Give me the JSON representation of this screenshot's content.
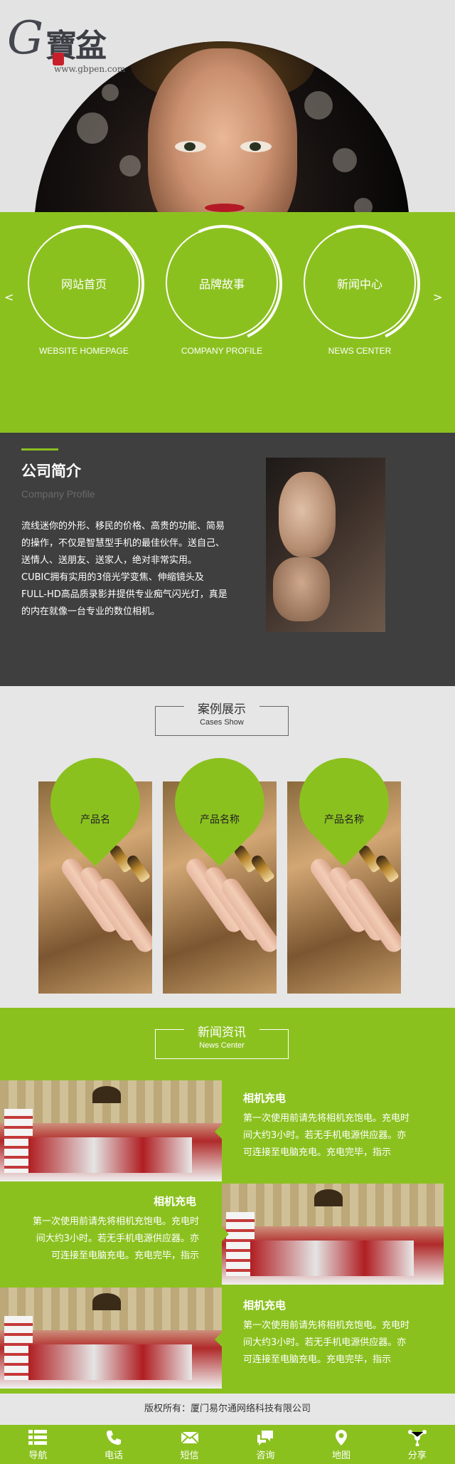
{
  "brand": {
    "logo_letter": "G",
    "logo_cn": "寶盆",
    "logo_url": "www.gbpen.com"
  },
  "nav": {
    "prev": "<",
    "next": ">",
    "items": [
      {
        "label": "网站首页",
        "en": "WEBSITE HOMEPAGE"
      },
      {
        "label": "品牌故事",
        "en": "COMPANY PROFILE"
      },
      {
        "label": "新闻中心",
        "en": "NEWS CENTER"
      }
    ]
  },
  "profile": {
    "title": "公司简介",
    "subtitle": "Company Profile",
    "text": "流线迷你的外形、移民的价格、高贵的功能、简易的操作，不仅是智慧型手机的最佳伙伴。送自己、送情人、送朋友、送家人，绝对非常实用。 CUBIC拥有实用的3倍光学变焦、伸缩镜头及FULL-HD高品质录影并提供专业痴气闪光灯，真是的内在就像一台专业的数位相机。"
  },
  "cases": {
    "title": "案例展示",
    "subtitle": "Cases Show",
    "items": [
      {
        "label": "产品名"
      },
      {
        "label": "产品名称"
      },
      {
        "label": "产品名称"
      }
    ]
  },
  "news": {
    "title": "新闻资讯",
    "subtitle": "News Center",
    "items": [
      {
        "title": "相机充电",
        "text": "第一次使用前请先将相机充饱电。充电时间大约3小时。若无手机电源供应器。亦可连接至电脑充电。充电完毕，指示"
      },
      {
        "title": "相机充电",
        "text": "第一次使用前请先将相机充饱电。充电时间大约3小时。若无手机电源供应器。亦可连接至电脑充电。充电完毕，指示"
      },
      {
        "title": "相机充电",
        "text": "第一次使用前请先将相机充饱电。充电时间大约3小时。若无手机电源供应器。亦可连接至电脑充电。充电完毕，指示"
      }
    ]
  },
  "footer": {
    "copyright": "版权所有：厦门易尔通网络科技有限公司"
  },
  "tabbar": {
    "items": [
      {
        "label": "导航",
        "icon": "menu-icon"
      },
      {
        "label": "电话",
        "icon": "phone-icon"
      },
      {
        "label": "短信",
        "icon": "mail-icon"
      },
      {
        "label": "咨询",
        "icon": "chat-icon"
      },
      {
        "label": "地图",
        "icon": "map-pin-icon"
      },
      {
        "label": "分享",
        "icon": "share-icon"
      }
    ]
  },
  "colors": {
    "accent": "#8bc11f",
    "dark": "#3f3f3f",
    "light": "#e6e6e6"
  }
}
